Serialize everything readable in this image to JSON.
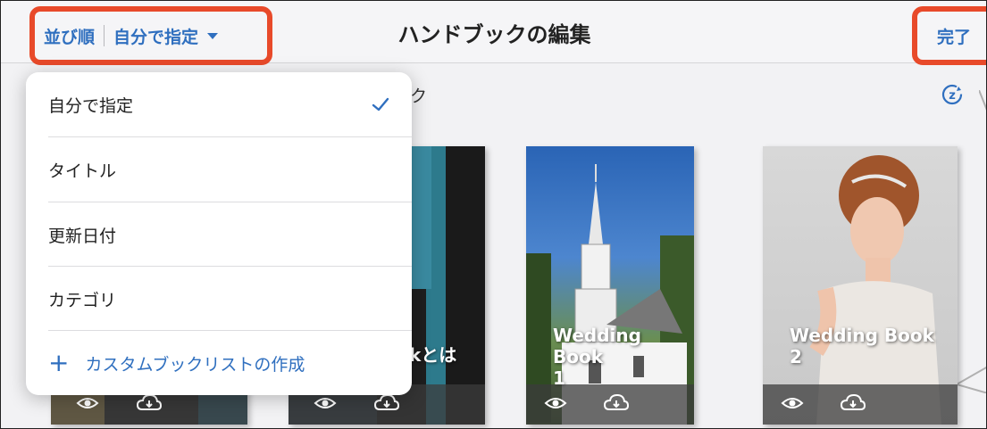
{
  "header": {
    "sort_label": "並び順",
    "sort_value": "自分で指定",
    "title": "ハンドブックの編集",
    "done_label": "完了"
  },
  "section": {
    "partial_label": "ク"
  },
  "menu": {
    "items": [
      {
        "label": "自分で指定",
        "selected": true
      },
      {
        "label": "タイトル",
        "selected": false
      },
      {
        "label": "更新日付",
        "selected": false
      },
      {
        "label": "カテゴリ",
        "selected": false
      }
    ],
    "create_label": "カスタムブックリストの作成"
  },
  "books": [
    {
      "title_line1": "",
      "title_line2": ""
    },
    {
      "title_line1": "kとは",
      "title_line2": ""
    },
    {
      "title_line1": "Wedding Book",
      "title_line2": "1"
    },
    {
      "title_line1": "Wedding Book",
      "title_line2": "2"
    }
  ],
  "colors": {
    "accent": "#2f6fbf",
    "highlight": "#e84a2a"
  },
  "icons": {
    "sync": "sync-icon",
    "view": "eye-icon",
    "download": "cloud-download-icon",
    "check": "checkmark-icon",
    "caret": "caret-down-icon"
  }
}
